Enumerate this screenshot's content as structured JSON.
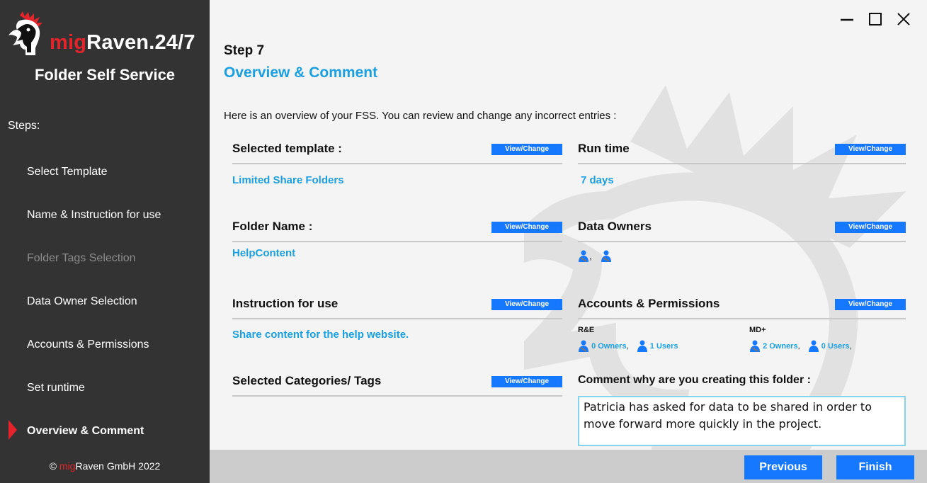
{
  "brand": {
    "name_prefix": "mig",
    "name_suffix": "Raven.24/7",
    "subtitle": "Folder Self Service",
    "copyright_symbol": "©",
    "copyright_prefix": "mig",
    "copyright_suffix": "Raven GmbH 2022"
  },
  "sidebar": {
    "steps_label": "Steps:",
    "steps": [
      {
        "label": "Select Template",
        "state": "normal"
      },
      {
        "label": "Name & Instruction for use",
        "state": "normal"
      },
      {
        "label": "Folder Tags Selection",
        "state": "disabled"
      },
      {
        "label": "Data Owner Selection",
        "state": "normal"
      },
      {
        "label": "Accounts & Permissions",
        "state": "normal"
      },
      {
        "label": "Set runtime",
        "state": "normal"
      },
      {
        "label": "Overview & Comment",
        "state": "active"
      }
    ]
  },
  "window": {
    "minimize_icon": "minimize-icon",
    "maximize_icon": "maximize-icon",
    "close_icon": "close-icon"
  },
  "main": {
    "step_number": "Step 7",
    "step_title": "Overview & Comment",
    "intro": "Here is an overview of your FSS. You can review and change any incorrect entries :",
    "view_change_label": "View/Change",
    "sections": {
      "template": {
        "title": "Selected template :",
        "value": "Limited Share Folders"
      },
      "runtime": {
        "title": "Run time",
        "value": "7 days"
      },
      "folder_name": {
        "title": "Folder Name :",
        "value": "HelpContent"
      },
      "data_owners": {
        "title": "Data Owners",
        "separator": ","
      },
      "instruction": {
        "title": "Instruction for use",
        "value": "Share content for the help website."
      },
      "accounts": {
        "title": "Accounts & Permissions",
        "groups": [
          {
            "name": "R&E",
            "owners": "0 Owners",
            "users": "1 Users",
            "owners_sep": ",",
            "users_sep": ""
          },
          {
            "name": "MD+",
            "owners": "2 Owners",
            "users": "0 Users",
            "owners_sep": ",",
            "users_sep": ","
          }
        ]
      },
      "categories": {
        "title": "Selected Categories/ Tags"
      }
    },
    "comment": {
      "title": "Comment why are you creating this folder :",
      "value": "Patricia has asked for data to be shared in order to move forward more quickly in the project."
    }
  },
  "footer": {
    "previous_label": "Previous",
    "finish_label": "Finish"
  },
  "colors": {
    "accent_blue": "#1a9fe0",
    "button_blue": "#1677ff",
    "brand_red": "#e4232b",
    "sidebar_bg": "#333333"
  }
}
